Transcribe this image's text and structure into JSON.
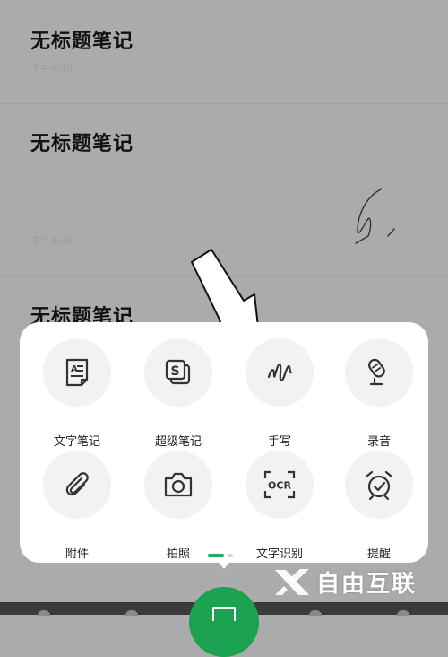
{
  "notes": [
    {
      "title": "无标题笔记",
      "time": "下午4:40"
    },
    {
      "title": "无标题笔记",
      "time": "下午4:38"
    },
    {
      "title": "无标题笔记",
      "time": ""
    }
  ],
  "tools": [
    {
      "label": "文字笔记",
      "icon": "text-note-icon"
    },
    {
      "label": "超级笔记",
      "icon": "super-note-icon"
    },
    {
      "label": "手写",
      "icon": "handwriting-icon"
    },
    {
      "label": "录音",
      "icon": "microphone-icon"
    },
    {
      "label": "附件",
      "icon": "paperclip-icon"
    },
    {
      "label": "拍照",
      "icon": "camera-icon"
    },
    {
      "label": "文字识别",
      "icon": "ocr-icon",
      "glyph": "OCR"
    },
    {
      "label": "提醒",
      "icon": "alarm-clock-icon"
    }
  ],
  "pager": {
    "pages": 2,
    "current": 1
  },
  "watermark": {
    "text": "自由互联"
  },
  "colors": {
    "accent": "#1aa250",
    "icon": "#333333",
    "sheet": "#ffffff",
    "overlay": "#ababab"
  }
}
